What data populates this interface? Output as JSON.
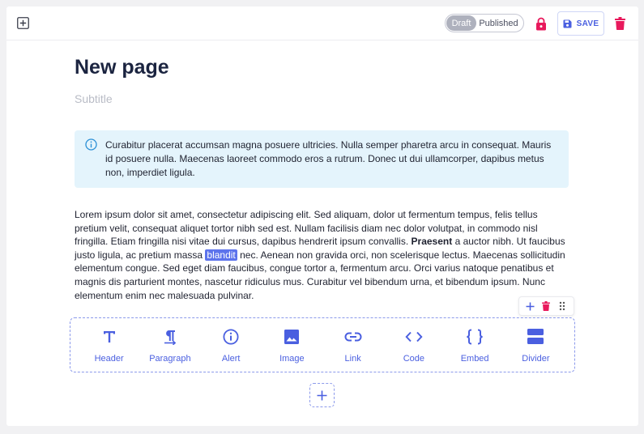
{
  "toolbar": {
    "status_draft": "Draft",
    "status_published": "Published",
    "save_label": "SAVE"
  },
  "page": {
    "title": "New page",
    "subtitle_placeholder": "Subtitle"
  },
  "alert": {
    "text": "Curabitur placerat accumsan magna posuere ultricies. Nulla semper pharetra arcu in consequat. Mauris id posuere nulla. Maecenas laoreet commodo eros a rutrum. Donec ut dui ullamcorper, dapibus metus non, imperdiet ligula."
  },
  "paragraph": {
    "part1": "Lorem ipsum dolor sit amet, consectetur adipiscing elit. Sed aliquam, dolor ut fermentum tempus, felis tellus pretium velit, consequat aliquet tortor nibh sed est. Nullam facilisis diam nec dolor volutpat, in commodo nisl fringilla. Etiam fringilla nisi vitae dui cursus, dapibus hendrerit ipsum convallis. ",
    "bold": "Praesent",
    "part2": " a auctor nibh. Ut faucibus justo ligula, ac pretium massa ",
    "highlight": "blandit",
    "part3": " nec. Aenean non gravida orci, non scelerisque lectus. Maecenas sollicitudin elementum congue. Sed eget diam faucibus, congue tortor a, fermentum arcu. Orci varius natoque penatibus et magnis dis parturient montes, nascetur ridiculus mus. Curabitur vel bibendum urna, et bibendum ipsum. Nunc elementum enim nec malesuada pulvinar."
  },
  "block_picker": [
    {
      "label": "Header",
      "icon": "header-icon"
    },
    {
      "label": "Paragraph",
      "icon": "paragraph-icon"
    },
    {
      "label": "Alert",
      "icon": "alert-icon"
    },
    {
      "label": "Image",
      "icon": "image-icon"
    },
    {
      "label": "Link",
      "icon": "link-icon"
    },
    {
      "label": "Code",
      "icon": "code-icon"
    },
    {
      "label": "Embed",
      "icon": "embed-icon"
    },
    {
      "label": "Divider",
      "icon": "divider-icon"
    }
  ],
  "colors": {
    "accent": "#4a5fe0",
    "danger": "#e8195c",
    "alert_bg": "#e4f4fc",
    "highlight": "#5c73ec"
  }
}
